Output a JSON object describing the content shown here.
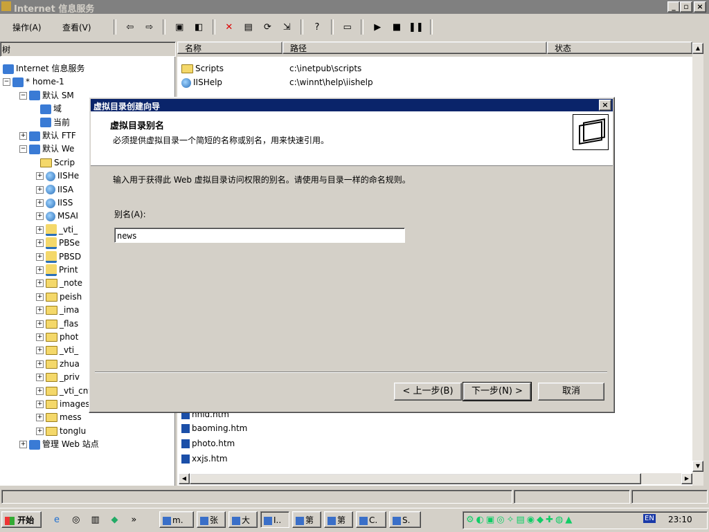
{
  "window": {
    "title": "Internet 信息服务",
    "min": "_",
    "max": "▫",
    "close": "×"
  },
  "menu": {
    "action": "操作(A)",
    "view": "查看(V)"
  },
  "tree": {
    "header": "树",
    "nodes": [
      {
        "label": "Internet 信息服务",
        "icon": "iis-icon"
      },
      {
        "label": "* home-1",
        "icon": "computer-icon"
      },
      {
        "label": "默认 SM",
        "icon": "smtp-icon"
      },
      {
        "label": "域",
        "icon": "domain-icon"
      },
      {
        "label": "当前",
        "icon": "session-icon"
      },
      {
        "label": "默认 FTF",
        "icon": "ftp-icon"
      },
      {
        "label": "默认 We",
        "icon": "web-icon"
      },
      {
        "label": "Scrip",
        "icon": "folder-icon"
      },
      {
        "label": "IISHe",
        "icon": "globe-icon"
      },
      {
        "label": "IISA",
        "icon": "globe-icon"
      },
      {
        "label": "IISS",
        "icon": "globe-icon"
      },
      {
        "label": "MSAI",
        "icon": "globe-icon"
      },
      {
        "label": "_vti_",
        "icon": "web-folder-icon"
      },
      {
        "label": "PBSe",
        "icon": "web-folder-icon"
      },
      {
        "label": "PBSD",
        "icon": "web-folder-icon"
      },
      {
        "label": "Print",
        "icon": "web-folder-icon"
      },
      {
        "label": "_note",
        "icon": "folder-icon"
      },
      {
        "label": "peish",
        "icon": "folder-icon"
      },
      {
        "label": "_ima",
        "icon": "folder-icon"
      },
      {
        "label": "_flas",
        "icon": "folder-icon"
      },
      {
        "label": "phot",
        "icon": "folder-icon"
      },
      {
        "label": "_vti_",
        "icon": "folder-icon"
      },
      {
        "label": "zhua",
        "icon": "folder-icon"
      },
      {
        "label": "_priv",
        "icon": "folder-icon"
      },
      {
        "label": "_vti_cnf",
        "icon": "folder-icon"
      },
      {
        "label": "images",
        "icon": "folder-icon"
      },
      {
        "label": "mess",
        "icon": "folder-icon"
      },
      {
        "label": "tonglu",
        "icon": "folder-icon"
      },
      {
        "label": "管理 Web 站点",
        "icon": "web-icon"
      }
    ]
  },
  "list": {
    "columns": [
      "名称",
      "路径",
      "状态"
    ],
    "rows_top": [
      {
        "name": "Scripts",
        "path": "c:\\inetpub\\scripts"
      },
      {
        "name": "IISHelp",
        "path": "c:\\winnt\\help\\iishelp"
      }
    ],
    "rows_bottom": [
      "hnld.htm",
      "baoming.htm",
      "photo.htm",
      "xxjs.htm"
    ]
  },
  "dialog": {
    "title": "虚拟目录创建向导",
    "heading": "虚拟目录别名",
    "subheading": "必须提供虚拟目录一个简短的名称或别名，用来快速引用。",
    "instruction": "输入用于获得此 Web 虚拟目录访问权限的别名。请使用与目录一样的命名规则。",
    "alias_label": "别名(A):",
    "alias_value": "news",
    "back": "< 上一步(B)",
    "next": "下一步(N) >",
    "cancel": "取消"
  },
  "taskbar": {
    "start": "开始",
    "tasks": [
      "m.",
      "张",
      "大",
      "I..",
      "第",
      "第",
      "C.",
      "S."
    ],
    "lang": "EN",
    "clock": "23:10"
  }
}
